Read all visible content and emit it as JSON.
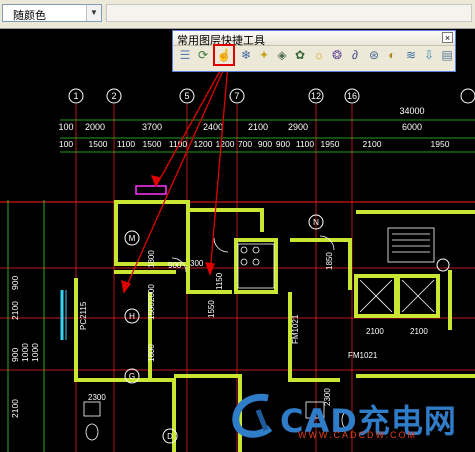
{
  "topbar": {
    "color_select": "随颜色"
  },
  "toolbar": {
    "title": "常用图层快捷工具",
    "close": "×",
    "buttons": [
      "layers-stack",
      "layers-refresh",
      "pointer-hand",
      "layer-freeze",
      "bulb",
      "layer-iso",
      "layer-on",
      "sun",
      "layer-lock",
      "lock",
      "layer-unlock",
      "layer-copy",
      "layer-merge",
      "layer-move",
      "layer-delete"
    ]
  },
  "drawing": {
    "grid_top": [
      "1",
      "2",
      "5",
      "7",
      "12",
      "16"
    ],
    "grid_left": [
      "M",
      "H",
      "G",
      "D"
    ],
    "grid_right": [
      "N"
    ],
    "dim_row1": [
      "100",
      "2000",
      "3700",
      "2400",
      "2100",
      "2900",
      "34000",
      "6000"
    ],
    "dim_row2": [
      "100",
      "1500",
      "1100",
      "1500",
      "1100",
      "1200",
      "1200",
      "700",
      "900",
      "900",
      "1100",
      "1950",
      "2100",
      "1950"
    ],
    "left_dims": [
      "900",
      "2100",
      "900",
      "1000",
      "1000",
      "2100"
    ],
    "labels": [
      "PC2115",
      "1800",
      "900",
      "300",
      "1150",
      "1500",
      "2000",
      "1600",
      "1850",
      "2100",
      "2100",
      "2300",
      "1550",
      "FM1021",
      "FM1021",
      "2300"
    ]
  },
  "watermark": {
    "brand": "CAD充电网",
    "url": "WWW.CADCDW.COM"
  },
  "colors": {
    "wall": "#c8e632",
    "grid": "#ffffff",
    "axis_red": "#ff2020",
    "dim_green": "#32d232",
    "cyan": "#3ad2f2",
    "highlight": "#e00000"
  }
}
